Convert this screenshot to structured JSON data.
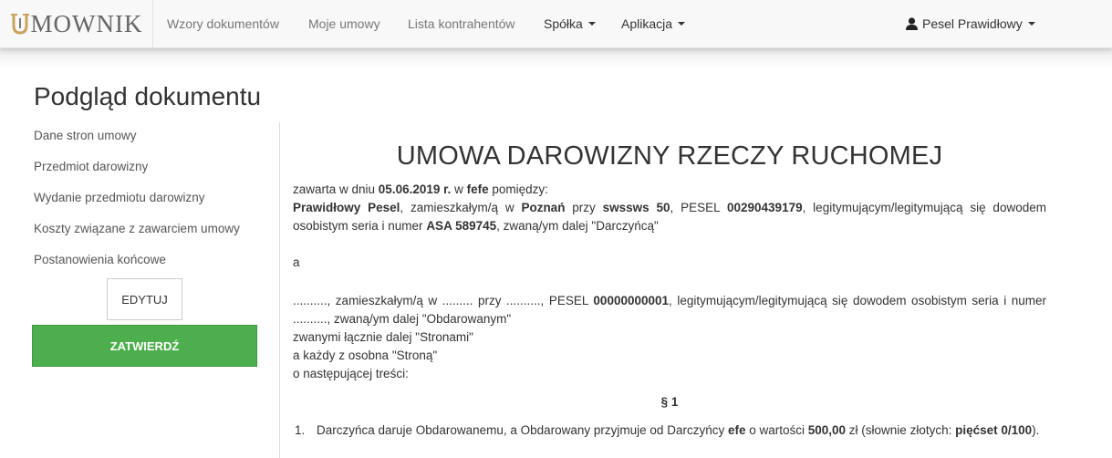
{
  "navbar": {
    "brand": "MOWNIK",
    "items": [
      {
        "label": "Wzory dokumentów"
      },
      {
        "label": "Moje umowy"
      },
      {
        "label": "Lista kontrahentów"
      },
      {
        "label": "Spółka"
      },
      {
        "label": "Aplikacja"
      }
    ],
    "user": "Pesel Prawidłowy"
  },
  "page": {
    "title": "Podgląd dokumentu"
  },
  "sidebar": {
    "items": [
      {
        "label": "Dane stron umowy"
      },
      {
        "label": "Przedmiot darowizny"
      },
      {
        "label": "Wydanie przedmiotu darowizny"
      },
      {
        "label": "Koszty związane z zawarciem umowy"
      },
      {
        "label": "Postanowienia końcowe"
      }
    ],
    "edit_label": "EDYTUJ",
    "confirm_label": "ZATWIERDŹ"
  },
  "colors": {
    "confirm_button": "#4cae4c",
    "brand_mark": "#c9a35a"
  },
  "document": {
    "title": "UMOWA DAROWIZNY RZECZY RUCHOMEJ",
    "p1": {
      "t1": "zawarta w dniu ",
      "date": "05.06.2019 r.",
      "t2": " w ",
      "place": "fefe",
      "t3": " pomiędzy:",
      "donor_name": "Prawidłowy Pesel",
      "t4": ", zamieszkałym/ą w ",
      "city": "Poznań",
      "t5": " przy ",
      "street": "swssws 50",
      "t6": ", PESEL ",
      "pesel": "00290439179",
      "t7": ", legitymującym/legitymującą się dowodem osobistym seria i numer ",
      "id_number": "ASA 589745",
      "t8": ", zwaną/ym dalej \"Darczyńcą\""
    },
    "and": "a",
    "p2": {
      "t1": ".........., zamieszkałym/ą w ......... przy .........., PESEL ",
      "pesel": "00000000001",
      "t2": ", legitymującym/legitymującą się dowodem osobistym seria i numer .........., zwaną/ym dalej \"Obdarowanym\"",
      "line2": "zwanymi łącznie dalej \"Stronami\"",
      "line3": "a każdy z osobna \"Stroną\"",
      "line4": "o następującej treści:"
    },
    "section": "§ 1",
    "item1": {
      "num": "1.",
      "t1": "Darczyńca daruje Obdarowanemu, a Obdarowany przyjmuje od Darczyńcy ",
      "item": "efe",
      "t2": " o wartości ",
      "value": "500,00",
      "t3": " zł (słownie złotych: ",
      "words": "pięćset 0/100",
      "t4": ")."
    }
  }
}
